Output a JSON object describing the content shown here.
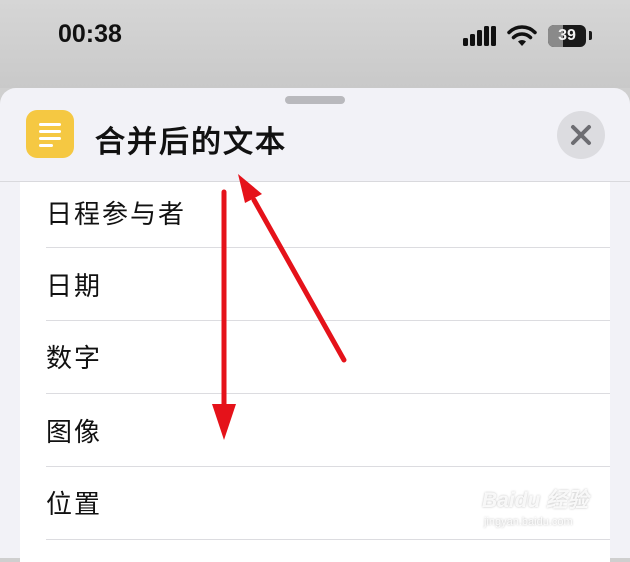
{
  "status_bar": {
    "time": "00:38",
    "battery_level": "39",
    "battery_fraction": 0.39
  },
  "sheet": {
    "title": "合并后的文本",
    "app_icon": "text-lines-icon",
    "close_icon": "close-icon"
  },
  "list": {
    "items": [
      {
        "label": "日程参与者"
      },
      {
        "label": "日期"
      },
      {
        "label": "数字"
      },
      {
        "label": "图像"
      },
      {
        "label": "位置"
      }
    ]
  },
  "annotations": {
    "arrow_color": "#e5121a"
  },
  "watermark": {
    "logo_text": "Baidu 经验",
    "url": "jingyan.baidu.com"
  },
  "colors": {
    "app_icon_bg": "#f5c842",
    "sheet_bg": "#f2f2f7"
  }
}
